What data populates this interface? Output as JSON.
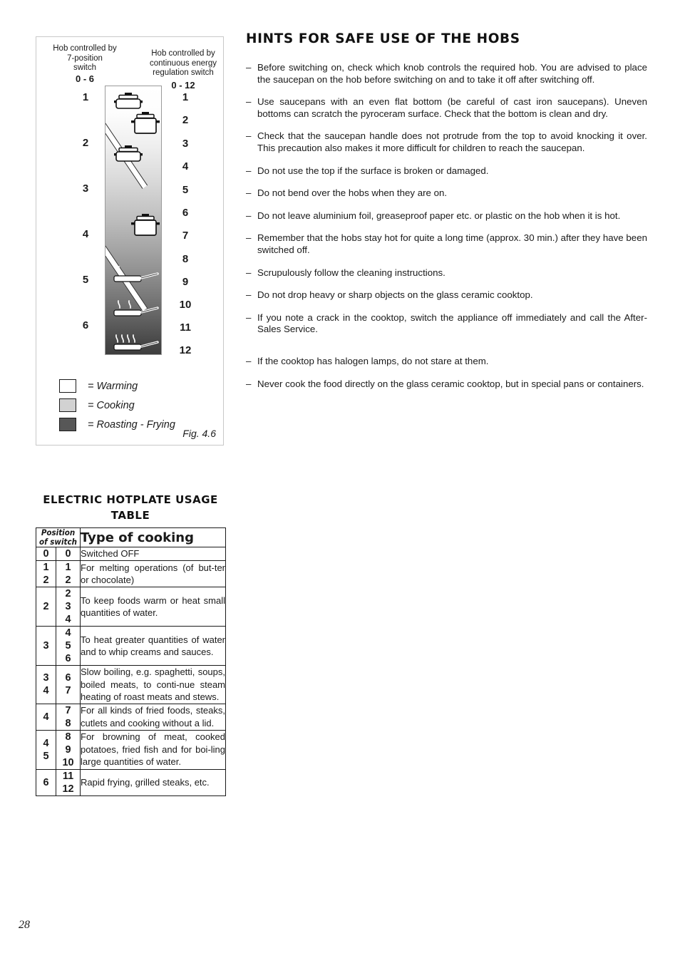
{
  "figure": {
    "header_left": {
      "line1": "Hob controlled by",
      "line2": "7-position",
      "line3": "switch",
      "range": "0 - 6"
    },
    "header_right": {
      "line1": "Hob controlled by",
      "line2": "continuous energy",
      "line3": "regulation switch",
      "range": "0 - 12"
    },
    "scale_left": [
      "1",
      "2",
      "3",
      "4",
      "5",
      "6"
    ],
    "scale_right": [
      "1",
      "2",
      "3",
      "4",
      "5",
      "6",
      "7",
      "8",
      "9",
      "10",
      "11",
      "12"
    ],
    "legend": [
      {
        "swatch": "white",
        "label": "= Warming"
      },
      {
        "swatch": "light-gray",
        "label": "= Cooking"
      },
      {
        "swatch": "dark-gray",
        "label": "= Roasting - Frying"
      }
    ],
    "caption": "Fig. 4.6",
    "icons": [
      "pot-lid-small",
      "pot-lid-tall",
      "pot-lid-small",
      "pot-lid-tall",
      "frying-pan-1-steam",
      "frying-pan-2-steam",
      "frying-pan-4-steam"
    ]
  },
  "hints": {
    "title": "HINTS FOR SAFE USE OF THE HOBS",
    "dash": "–",
    "items": [
      "Before switching on, check which knob controls the required hob. You are advised to place the saucepan on the hob before switching on and to take it off after switching off.",
      "Use saucepans with an even flat bottom (be careful of cast iron saucepans). Uneven bottoms can scratch the pyroceram surface. Check that the bottom is clean and dry.",
      "Check that the saucepan handle does not protrude from the top to avoid knocking it over. This precaution also makes it more difficult for children to reach the saucepan.",
      "Do not use the top if the surface is broken or damaged.",
      "Do not bend over the hobs when they are on.",
      "Do not leave aluminium foil, greaseproof paper etc. or plastic on the hob when it is hot.",
      "Remember that the hobs stay hot for quite a long time (approx. 30 min.) after they have been switched off.",
      "Scrupulously follow the cleaning instructions.",
      "Do not drop heavy or sharp objects on the glass ceramic cooktop.",
      "If you note a crack in the cooktop, switch the appliance off immediately and call the After-Sales Service.",
      "If the cooktop has halogen lamps, do not stare at them.",
      "Never cook the food directly on the glass ceramic cooktop, but in special pans or containers."
    ]
  },
  "usage_table": {
    "title_line1": "ELECTRIC HOTPLATE USAGE",
    "title_line2": "TABLE",
    "header": {
      "position_l1": "Position",
      "position_l2": "of switch",
      "type": "Type of cooking"
    },
    "rows": [
      {
        "switch7": "0",
        "switch12": "0",
        "desc": "Switched OFF"
      },
      {
        "switch7": "1\n2",
        "switch12": "1\n2",
        "desc": "For melting operations (of but-​ter or chocolate)"
      },
      {
        "switch7": "2",
        "switch12": "2\n3\n4",
        "desc": "To keep foods warm or heat small quantities of water."
      },
      {
        "switch7": "3",
        "switch12": "4\n5\n6",
        "desc": "To heat greater quantities of water and to whip creams and sauces."
      },
      {
        "switch7": "3\n4",
        "switch12": "6\n7",
        "desc": "Slow boiling, e.g. spaghetti, soups, boiled meats, to conti-nue steam heating of roast meats and stews."
      },
      {
        "switch7": "4",
        "switch12": "7\n8",
        "desc": "For all kinds of fried foods, steaks, cutlets and cooking without a lid."
      },
      {
        "switch7": "4\n5",
        "switch12": "8\n9\n10",
        "desc": "For browning of meat, cooked potatoes, fried fish and for boi-ling large quantities of water."
      },
      {
        "switch7": "6",
        "switch12": "11\n12",
        "desc": "Rapid frying, grilled steaks, etc."
      }
    ]
  },
  "page": {
    "number": "28"
  }
}
